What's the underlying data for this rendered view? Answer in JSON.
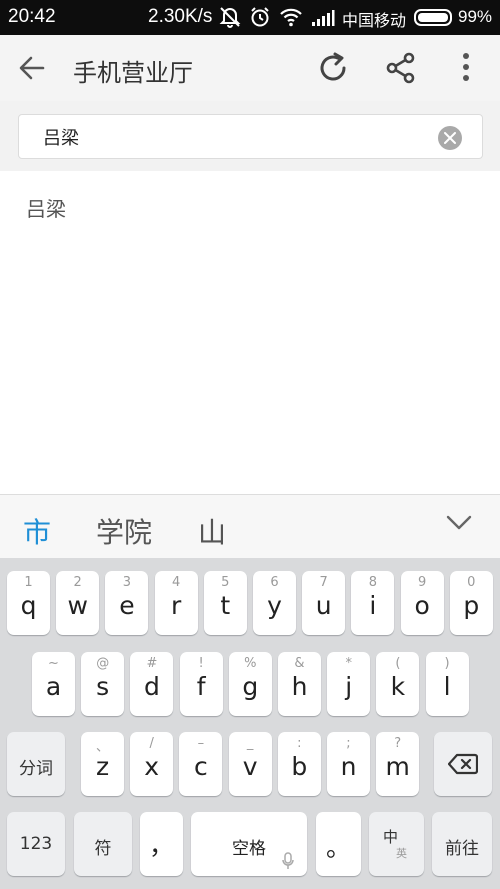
{
  "status_bar": {
    "time": "20:42",
    "net_speed": "2.30K/s",
    "carrier": "中国移动",
    "battery_pct": "99%",
    "battery_level": 0.99
  },
  "app_bar": {
    "title": "手机营业厅",
    "icons": [
      "back-arrow-icon",
      "refresh-icon",
      "share-icon",
      "more-vert-icon"
    ]
  },
  "search": {
    "value": "吕梁"
  },
  "suggestions": [
    "吕梁"
  ],
  "candidates": [
    "市",
    "学院",
    "山"
  ],
  "keyboard": {
    "row1": [
      {
        "k": "q",
        "s": "1"
      },
      {
        "k": "w",
        "s": "2"
      },
      {
        "k": "e",
        "s": "3"
      },
      {
        "k": "r",
        "s": "4"
      },
      {
        "k": "t",
        "s": "5"
      },
      {
        "k": "y",
        "s": "6"
      },
      {
        "k": "u",
        "s": "7"
      },
      {
        "k": "i",
        "s": "8"
      },
      {
        "k": "o",
        "s": "9"
      },
      {
        "k": "p",
        "s": "0"
      }
    ],
    "row2": [
      {
        "k": "a",
        "s": "~"
      },
      {
        "k": "s",
        "s": "@"
      },
      {
        "k": "d",
        "s": "#"
      },
      {
        "k": "f",
        "s": "!"
      },
      {
        "k": "g",
        "s": "%"
      },
      {
        "k": "h",
        "s": "&"
      },
      {
        "k": "j",
        "s": "*"
      },
      {
        "k": "k",
        "s": "("
      },
      {
        "k": "l",
        "s": ")"
      }
    ],
    "row3": [
      {
        "k": "z",
        "s": "、"
      },
      {
        "k": "x",
        "s": "/"
      },
      {
        "k": "c",
        "s": "–"
      },
      {
        "k": "v",
        "s": "_"
      },
      {
        "k": "b",
        "s": ":"
      },
      {
        "k": "n",
        "s": ";"
      },
      {
        "k": "m",
        "s": "?"
      }
    ],
    "split_label": "分词",
    "num_label": "123",
    "symbol_label": "符",
    "comma_label": "，",
    "space_label": "空格",
    "period_label": "。",
    "lang_label": "中",
    "lang_sub": "英",
    "enter_label": "前往"
  },
  "colors": {
    "status_bg": "#0d0d0d",
    "appbar_bg": "#f4f4f4",
    "candidate_active": "#1f8fd6",
    "keyboard_bg": "#d9dadc"
  }
}
